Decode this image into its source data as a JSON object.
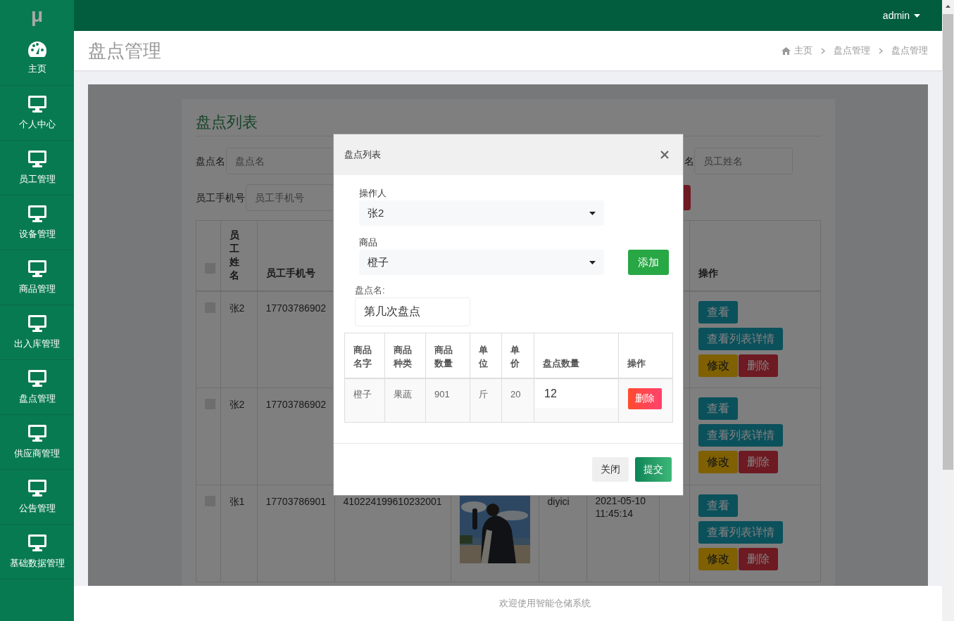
{
  "brand": {
    "logo": "μ"
  },
  "sidebar": {
    "items": [
      {
        "label": "主页",
        "kind": "gauge"
      },
      {
        "label": "个人中心",
        "kind": "monitor"
      },
      {
        "label": "员工管理",
        "kind": "monitor"
      },
      {
        "label": "设备管理",
        "kind": "monitor"
      },
      {
        "label": "商品管理",
        "kind": "monitor"
      },
      {
        "label": "出入库管理",
        "kind": "monitor"
      },
      {
        "label": "盘点管理",
        "kind": "monitor"
      },
      {
        "label": "供应商管理",
        "kind": "monitor"
      },
      {
        "label": "公告管理",
        "kind": "monitor"
      },
      {
        "label": "基础数据管理",
        "kind": "monitor"
      }
    ]
  },
  "topbar": {
    "user": "admin"
  },
  "page": {
    "title": "盘点管理",
    "breadcrumb": [
      "主页",
      "盘点管理",
      "盘点管理"
    ]
  },
  "list_panel": {
    "title": "盘点列表",
    "filters": [
      {
        "label": "盘点名",
        "placeholder": "盘点名"
      },
      {
        "label": "名",
        "placeholder": "员工姓名"
      },
      {
        "label": "员工手机号",
        "placeholder": "员工手机号"
      }
    ],
    "table": {
      "select_all_checked": false,
      "columns": {
        "name": "员工姓名",
        "phone": "员工手机号",
        "actions": "操作"
      },
      "rows": [
        {
          "checked": false,
          "name": "张2",
          "phone": "17703786902",
          "actions": [
            {
              "label": "查看",
              "kind": "view"
            },
            {
              "label": "查看列表详情",
              "kind": "detail"
            },
            {
              "label": "修改",
              "kind": "edit"
            },
            {
              "label": "删除",
              "kind": "delete"
            }
          ]
        },
        {
          "checked": false,
          "name": "张2",
          "phone": "17703786902",
          "actions": [
            {
              "label": "查看",
              "kind": "view"
            },
            {
              "label": "查看列表详情",
              "kind": "detail"
            },
            {
              "label": "修改",
              "kind": "edit"
            },
            {
              "label": "删除",
              "kind": "delete"
            }
          ]
        },
        {
          "checked": false,
          "name": "张1",
          "phone": "17703786901",
          "id_number": "410224199610232001",
          "inventory_name": "diyici",
          "created": "2021-05-10 11:45:14",
          "actions": [
            {
              "label": "查看",
              "kind": "view"
            },
            {
              "label": "查看列表详情",
              "kind": "detail"
            },
            {
              "label": "修改",
              "kind": "edit"
            },
            {
              "label": "删除",
              "kind": "delete"
            }
          ]
        }
      ]
    }
  },
  "modal": {
    "title": "盘点列表",
    "operator": {
      "label": "操作人",
      "value": "张2"
    },
    "product": {
      "label": "商品",
      "value": "橙子"
    },
    "add_button": "添加",
    "name_field": {
      "label": "盘点名:",
      "value": "第几次盘点"
    },
    "table": {
      "columns": [
        "商品名字",
        "商品种类",
        "商品数量",
        "单位",
        "单价",
        "盘点数量",
        "操作"
      ],
      "rows": [
        {
          "name": "橙子",
          "category": "果蔬",
          "quantity": "901",
          "unit": "斤",
          "price": "20",
          "count": "12",
          "delete": "删除"
        }
      ]
    },
    "buttons": [
      {
        "label": "关闭",
        "kind": "secondary"
      },
      {
        "label": "提交",
        "kind": "primary"
      }
    ]
  },
  "footer": {
    "text": "欢迎使用智能仓储系统"
  }
}
